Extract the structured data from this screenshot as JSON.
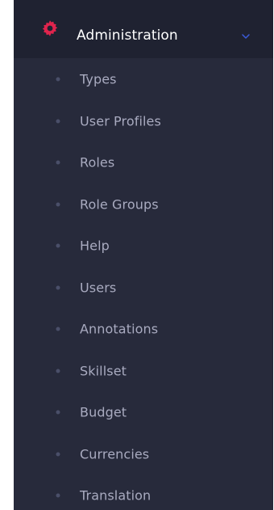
{
  "sidebar": {
    "section": {
      "title": "Administration",
      "icon": "gear-icon",
      "chevron_icon": "chevron-down-icon",
      "accent_color": "#e0244d",
      "chevron_color": "#3b5bdb"
    },
    "items": [
      {
        "label": "Types"
      },
      {
        "label": "User Profiles"
      },
      {
        "label": "Roles"
      },
      {
        "label": "Role Groups"
      },
      {
        "label": "Help"
      },
      {
        "label": "Users"
      },
      {
        "label": "Annotations"
      },
      {
        "label": "Skillset"
      },
      {
        "label": "Budget"
      },
      {
        "label": "Currencies"
      },
      {
        "label": "Translation"
      }
    ]
  }
}
